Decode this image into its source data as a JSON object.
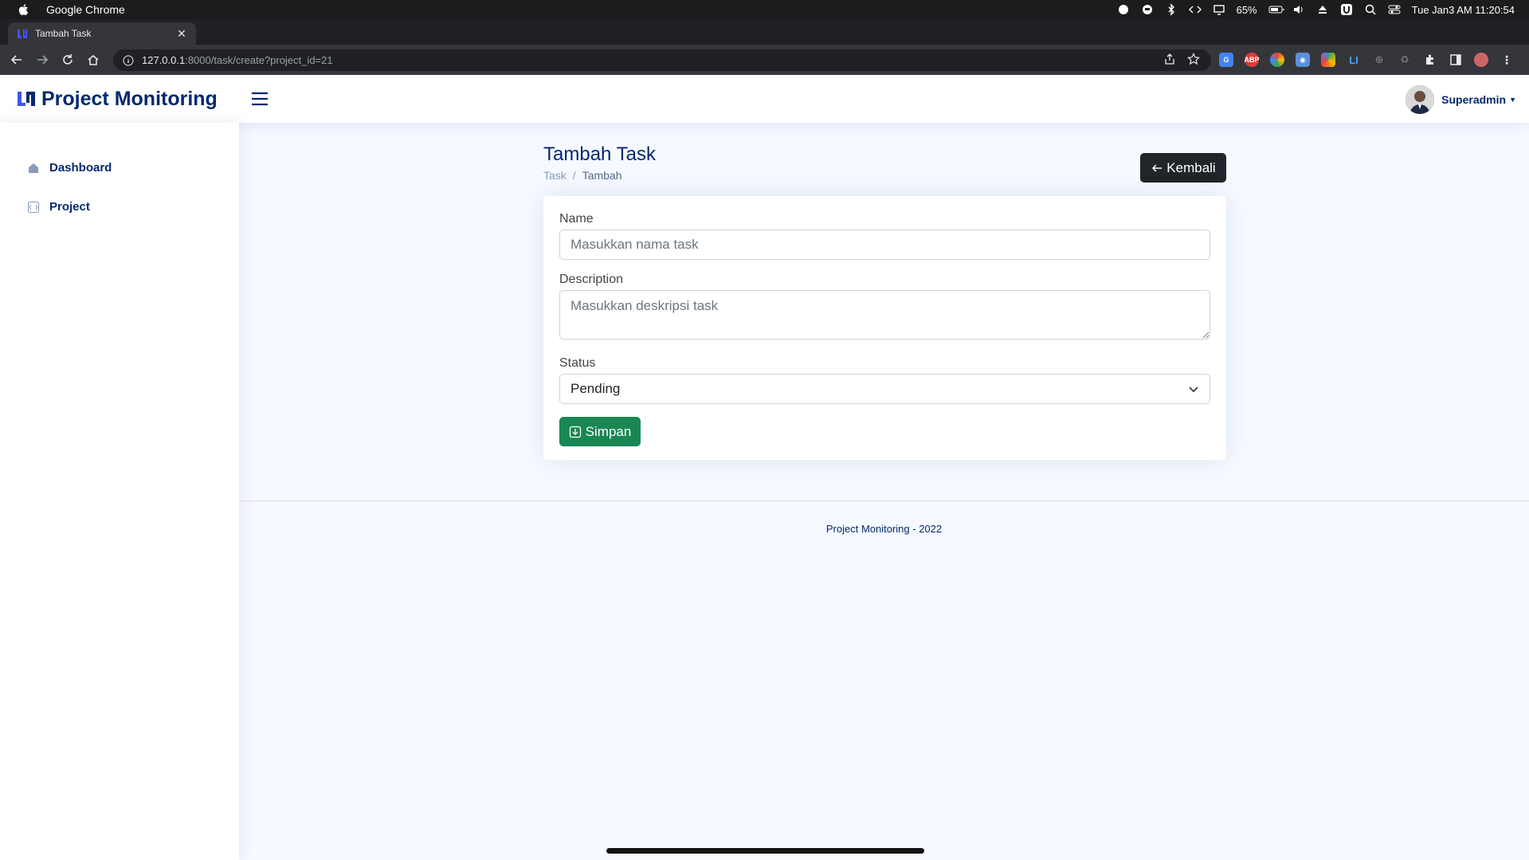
{
  "system_bar": {
    "app_name": "Google Chrome",
    "battery": "65%",
    "datetime": "Tue Jan3 AM 11:20:54"
  },
  "browser": {
    "tab_title": "Tambah Task",
    "url_host": "127.0.0.1",
    "url_rest": ":8000/task/create?project_id=21"
  },
  "header": {
    "logo_text": "Project Monitoring",
    "user_name": "Superadmin"
  },
  "sidebar": {
    "items": [
      {
        "label": "Dashboard",
        "icon": "grid-icon"
      },
      {
        "label": "Project",
        "icon": "project-icon"
      }
    ]
  },
  "page": {
    "title": "Tambah Task",
    "breadcrumb": [
      "Task",
      "/",
      "Tambah"
    ],
    "back_label": "Kembali"
  },
  "form": {
    "name_label": "Name",
    "name_placeholder": "Masukkan nama task",
    "description_label": "Description",
    "description_placeholder": "Masukkan deskripsi task",
    "status_label": "Status",
    "status_value": "Pending",
    "save_label": "Simpan"
  },
  "footer": {
    "text": "Project Monitoring - 2022"
  },
  "colors": {
    "brand": "#012970",
    "accent": "#4154f1",
    "save": "#198754",
    "back": "#212529"
  }
}
